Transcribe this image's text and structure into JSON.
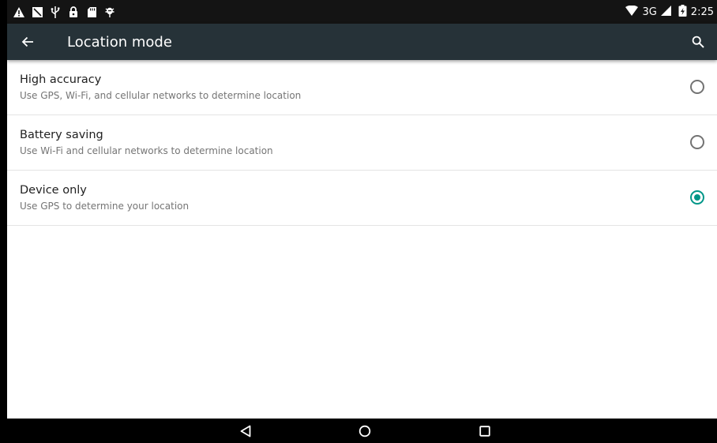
{
  "statusbar": {
    "left_icons": [
      "warning-icon",
      "no-sim-icon",
      "usb-icon",
      "lock-icon",
      "sd-card-icon",
      "debug-icon"
    ],
    "network_type": "3G",
    "time": "2:25"
  },
  "toolbar": {
    "title": "Location mode",
    "back_icon": "arrow-back-icon",
    "search_icon": "search-icon"
  },
  "options": [
    {
      "title": "High accuracy",
      "subtitle": "Use GPS, Wi-Fi, and cellular networks to determine location",
      "selected": false
    },
    {
      "title": "Battery saving",
      "subtitle": "Use Wi-Fi and cellular networks to determine location",
      "selected": false
    },
    {
      "title": "Device only",
      "subtitle": "Use GPS to determine your location",
      "selected": true
    }
  ],
  "navbar": {
    "buttons": [
      "back-triangle-icon",
      "home-circle-icon",
      "recents-square-icon"
    ]
  },
  "colors": {
    "toolbar": "#263238",
    "statusbar": "#141414",
    "accent": "#009688"
  }
}
